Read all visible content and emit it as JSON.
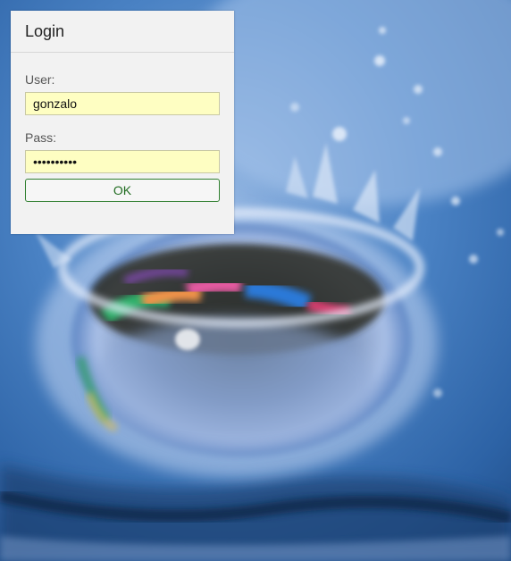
{
  "dialog": {
    "title": "Login",
    "user_label": "User:",
    "user_value": "gonzalo",
    "pass_label": "Pass:",
    "pass_value": "••••••••••",
    "ok_label": "OK"
  },
  "colors": {
    "dialog_background": "#f2f2f2",
    "input_background": "#fefec2",
    "ok_button_border": "#2f7f2f",
    "ok_button_text": "#1f6b1f",
    "wallpaper_base": "#3d73b0"
  },
  "wallpaper": {
    "subject": "water-splash-photo"
  }
}
